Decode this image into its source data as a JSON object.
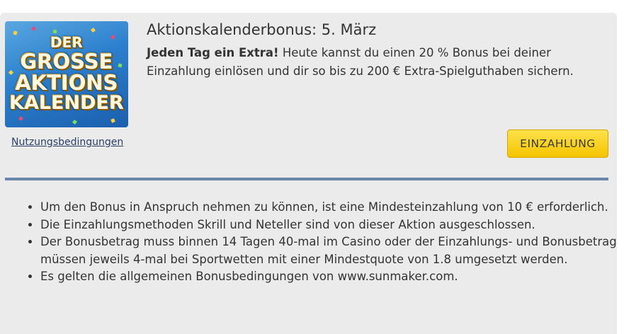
{
  "promo": {
    "image_lines": [
      "DER",
      "GROSSE",
      "AKTIONS",
      "KALENDER"
    ],
    "title": "Aktionskalenderbonus: 5. März",
    "lead_bold": "Jeden Tag ein Extra!",
    "lead_text": " Heute kannst du einen 20 % Bonus bei deiner Einzahlung einlösen und dir so bis zu 200 € Extra-Spielguthaben sichern.",
    "terms_link": "Nutzungsbedingungen",
    "cta_label": "EINZAHLUNG"
  },
  "rules": [
    "Um den Bonus in Anspruch nehmen zu können, ist eine Mindesteinzahlung von 10 € erforderlich.",
    "Die Einzahlungsmethoden Skrill und Neteller sind von dieser Aktion ausgeschlossen.",
    "Der Bonusbetrag muss binnen 14 Tagen 40-mal im Casino oder der Einzahlungs- und Bonusbetrag müssen jeweils 4-mal bei Sportwetten mit einer Mindestquote von 1.8 umgesetzt werden.",
    "Es gelten die allgemeinen Bonusbedingungen von www.sunmaker.com."
  ],
  "colors": {
    "panel": "#ebebeb",
    "divider": "#6a87ab",
    "cta": "#f5c400",
    "link": "#2a3f66"
  }
}
